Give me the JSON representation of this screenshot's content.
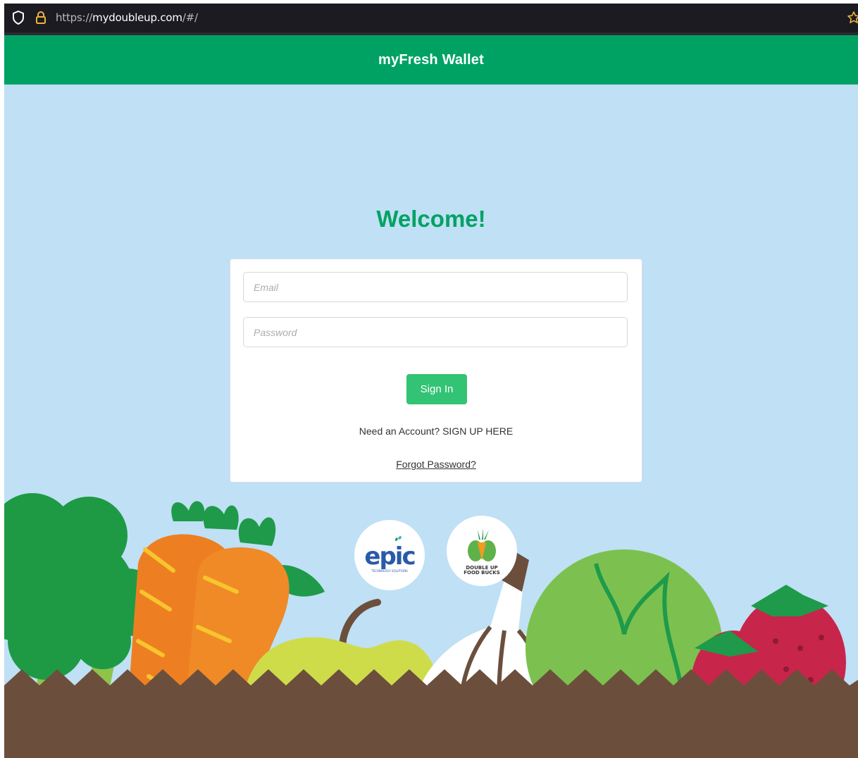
{
  "browser": {
    "url_scheme": "https://",
    "url_host": "mydoubleup.com",
    "url_path": "/#/",
    "icons": [
      "shield-icon",
      "lock-icon",
      "star-bookmark-icon"
    ]
  },
  "header": {
    "title": "myFresh Wallet"
  },
  "main": {
    "welcome": "Welcome!",
    "email": {
      "placeholder": "Email",
      "value": ""
    },
    "password": {
      "placeholder": "Password",
      "value": ""
    },
    "signin_label": "Sign In",
    "need_account_text": "Need an Account?",
    "signup_link": "SIGN UP HERE",
    "forgot_link": "Forgot Password?"
  },
  "logos": [
    {
      "name": "epic",
      "wordmark": "epic",
      "tagline": "TECHNOLOGY SOLUTIONS"
    },
    {
      "name": "double-up-food-bucks",
      "wordmark_line1": "DOUBLE UP",
      "wordmark_line2": "FOOD BUCKS"
    }
  ],
  "colors": {
    "brand_green": "#00a264",
    "button_green": "#33c374",
    "sky": "#bfe0f5",
    "soil": "#6b4f3c",
    "browser_chrome": "#1c1b22"
  }
}
